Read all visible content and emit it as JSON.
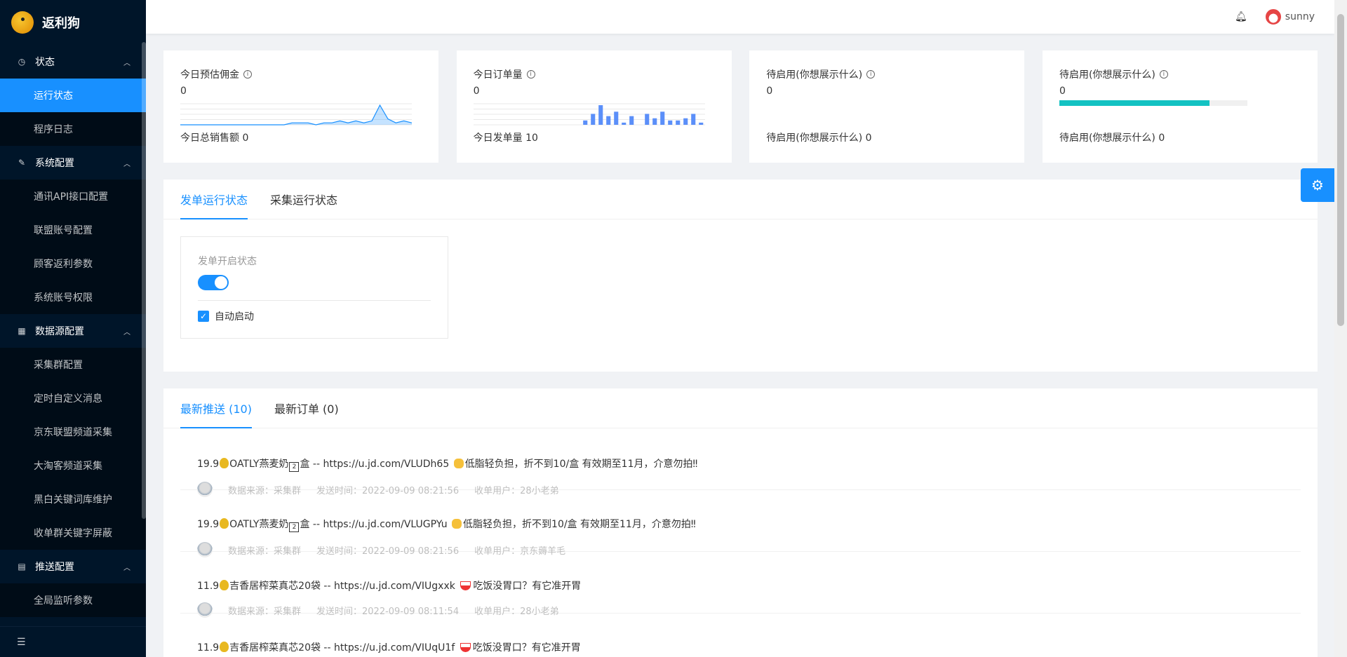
{
  "app": {
    "title": "返利狗"
  },
  "sidebar": {
    "groups": [
      {
        "label": "状态",
        "items": [
          "运行状态",
          "程序日志"
        ]
      },
      {
        "label": "系统配置",
        "items": [
          "通讯API接口配置",
          "联盟账号配置",
          "顾客返利参数",
          "系统账号权限"
        ]
      },
      {
        "label": "数据源配置",
        "items": [
          "采集群配置",
          "定时自定义消息",
          "京东联盟频道采集",
          "大淘客频道采集",
          "黑白关键词库维护",
          "收单群关键字屏蔽"
        ]
      },
      {
        "label": "推送配置",
        "items": [
          "全局监听参数"
        ]
      }
    ],
    "active_item": "运行状态"
  },
  "header": {
    "username": "sunny"
  },
  "cards": [
    {
      "title": "今日预估佣金",
      "value": "0",
      "footer": "今日总销售额 0",
      "visual": "area-chart"
    },
    {
      "title": "今日订单量",
      "value": "0",
      "footer": "今日发单量 10",
      "visual": "bar-chart"
    },
    {
      "title": "待启用(你想展示什么)",
      "value": "0",
      "footer": "待启用(你想展示什么) 0",
      "visual": "none"
    },
    {
      "title": "待启用(你想展示什么)",
      "value": "0",
      "footer": "待启用(你想展示什么) 0",
      "visual": "progress",
      "progress_percent": 80
    }
  ],
  "status_section": {
    "tabs": [
      "发单运行状态",
      "采集运行状态"
    ],
    "active_tab": 0,
    "switch_label": "发单开启状态",
    "switch_on": true,
    "checkbox_label": "自动启动",
    "checkbox_checked": true
  },
  "feed_section": {
    "tabs": [
      "最新推送 (10)",
      "最新订单 (0)"
    ],
    "active_tab": 0,
    "items": [
      {
        "price": "19.9",
        "text1": "OATLY燕麦奶",
        "text2": "盒 -- https://u.jd.com/VLUDh65 ",
        "text3": "低脂轻负担，折不到10/盒 有效期至11月，介意勿拍‼",
        "source": "数据来源：采集群",
        "time": "发送时间：2022-09-09 08:21:56",
        "user": "收单用户：28小老弟"
      },
      {
        "price": "19.9",
        "text1": "OATLY燕麦奶",
        "text2": "盒 -- https://u.jd.com/VLUGPYu ",
        "text3": "低脂轻负担，折不到10/盒 有效期至11月，介意勿拍‼",
        "source": "数据来源：采集群",
        "time": "发送时间：2022-09-09 08:21:56",
        "user": "收单用户：京东薅羊毛"
      },
      {
        "price": "11.9",
        "text1": "吉香居榨菜真芯20袋 -- https://u.jd.com/VIUgxxk ",
        "text3": "吃饭没胃口？有它准开胃",
        "source": "数据来源：采集群",
        "time": "发送时间：2022-09-09 08:11:54",
        "user": "收单用户：28小老弟"
      },
      {
        "price": "11.9",
        "text1": "吉香居榨菜真芯20袋 -- https://u.jd.com/VIUqU1f ",
        "text3": "吃饭没胃口？有它准开胃"
      }
    ]
  },
  "chart_data": [
    {
      "type": "area",
      "x": [
        1,
        2,
        3,
        4,
        5,
        6,
        7,
        8,
        9,
        10,
        11,
        12,
        13,
        14,
        15,
        16,
        17,
        18,
        19,
        20,
        21,
        22,
        23,
        24,
        25,
        26,
        27,
        28,
        29,
        30
      ],
      "values": [
        0,
        0,
        0,
        0,
        0,
        0,
        0,
        0,
        0,
        0,
        0,
        0,
        0,
        0,
        1,
        1,
        1,
        0,
        1,
        1,
        2,
        1,
        2,
        1,
        2,
        10,
        3,
        1,
        2,
        1
      ]
    },
    {
      "type": "bar",
      "x": [
        1,
        2,
        3,
        4,
        5,
        6,
        7,
        8,
        9,
        10,
        11,
        12,
        13,
        14,
        15,
        16,
        17,
        18,
        19,
        20,
        21,
        22,
        23,
        24,
        25,
        26,
        27,
        28,
        29,
        30
      ],
      "values": [
        0,
        0,
        0,
        0,
        0,
        0,
        0,
        0,
        0,
        0,
        0,
        0,
        0,
        0,
        2,
        5,
        9,
        4,
        6,
        1,
        4,
        0,
        5,
        3,
        6,
        2,
        2,
        3,
        5,
        1
      ]
    }
  ],
  "colors": {
    "primary": "#1890ff",
    "sidebar": "#001529",
    "progress": "#13c2c2"
  }
}
